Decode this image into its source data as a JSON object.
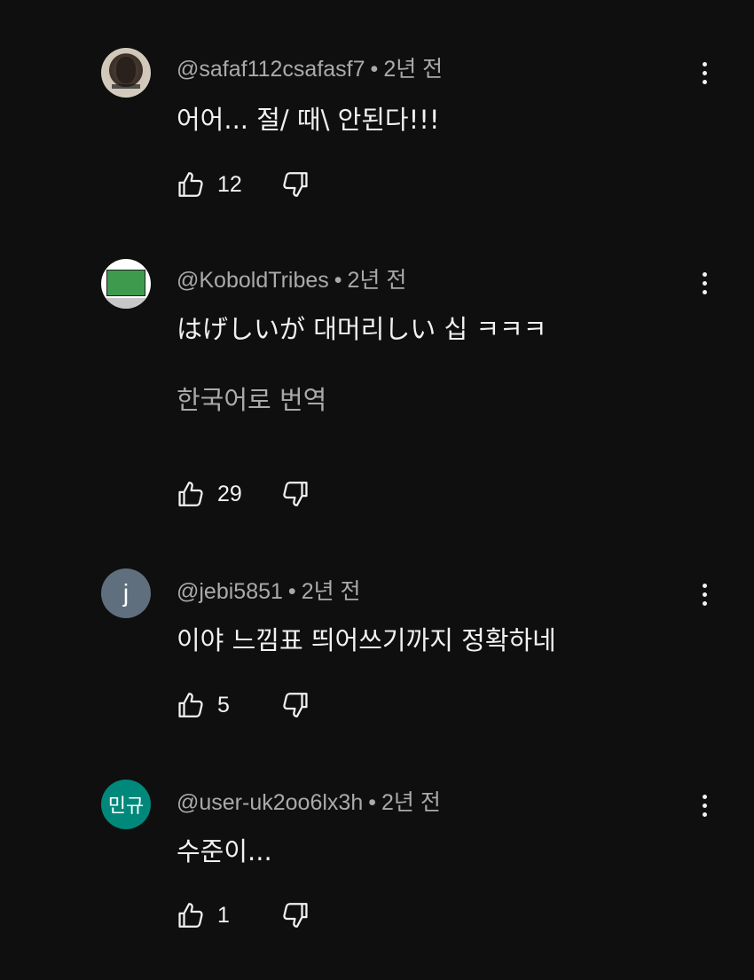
{
  "comments": [
    {
      "author": "@safaf112csafasf7",
      "time": "2년 전",
      "text": "어어... 절/ 때\\ 안된다!!!",
      "likes": "12",
      "avatar": {
        "kind": "photo"
      }
    },
    {
      "author": "@KoboldTribes",
      "time": "2년 전",
      "text": "はげしいが 대머리しい 십 ㅋㅋㅋ",
      "translate": "한국어로 번역",
      "likes": "29",
      "avatar": {
        "kind": "card"
      }
    },
    {
      "author": "@jebi5851",
      "time": "2년 전",
      "text": "이야 느낌표 띄어쓰기까지 정확하네",
      "likes": "5",
      "avatar": {
        "kind": "letter",
        "letter": "j",
        "color": "#5f6f7d"
      }
    },
    {
      "author": "@user-uk2oo6lx3h",
      "time": "2년 전",
      "text": "수준이...",
      "likes": "1",
      "avatar": {
        "kind": "letter",
        "letter": "민규",
        "color": "#00897b"
      }
    }
  ],
  "separator": "•",
  "icons": {
    "like": "thumb-up-icon",
    "dislike": "thumb-down-icon",
    "menu": "more-vert-icon"
  }
}
